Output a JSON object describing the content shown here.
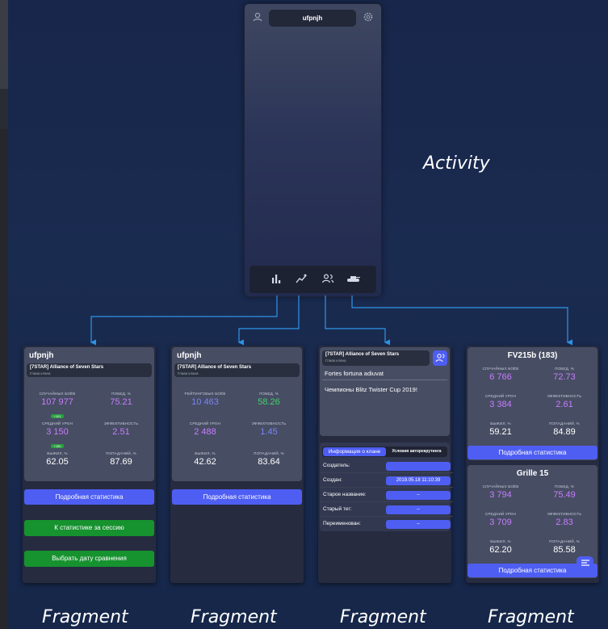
{
  "activity": {
    "title": "ufpnjh",
    "label": "Activity",
    "icons": [
      "profile-icon",
      "settings-icon"
    ],
    "nav_icons": [
      "stats-icon",
      "sessions-icon",
      "clan-icon",
      "tank-icon"
    ]
  },
  "fragment_label": "Fragment",
  "frag1": {
    "player": "ufpnjh",
    "clan_name": "[7STAR] Alliance of Seven Stars",
    "clan_role": "Глава клана",
    "stats": [
      {
        "label": "Случайных боёв",
        "value": "107 977",
        "color": "#c77dff",
        "badge": "+101"
      },
      {
        "label": "Побед, %",
        "value": "75.21",
        "color": "#c77dff",
        "badge": ""
      },
      {
        "label": "Средний урон",
        "value": "3 150",
        "color": "#c77dff",
        "badge": "+150"
      },
      {
        "label": "Эффективность",
        "value": "2.51",
        "color": "#c77dff",
        "badge": ""
      },
      {
        "label": "Выжил, %",
        "value": "62.05",
        "color": "#ffffff",
        "badge": ""
      },
      {
        "label": "Попаданий, %",
        "value": "87.69",
        "color": "#ffffff",
        "badge": ""
      }
    ],
    "btn_details": "Подробная статистика",
    "btn_session": "К статистике за сессию",
    "btn_compare": "Выбрать дату сравнения"
  },
  "frag2": {
    "player": "ufpnjh",
    "clan_name": "[7STAR] Alliance of Seven Stars",
    "clan_role": "Глава клана",
    "stats": [
      {
        "label": "Рейтинговых боёв",
        "value": "10 463",
        "color": "#7a86f5"
      },
      {
        "label": "Побед, %",
        "value": "58.26",
        "color": "#3fd46a"
      },
      {
        "label": "Средний урон",
        "value": "2 488",
        "color": "#c77dff"
      },
      {
        "label": "Эффективность",
        "value": "1.45",
        "color": "#7a86f5"
      },
      {
        "label": "Выжил, %",
        "value": "42.62",
        "color": "#ffffff"
      },
      {
        "label": "Попаданий, %",
        "value": "83.64",
        "color": "#ffffff"
      }
    ],
    "btn_details": "Подробная статистика"
  },
  "frag3": {
    "clan_name": "[7STAR] Alliance of Seven Stars",
    "clan_role": "Глава клана",
    "motto": "Fortes fortuna adiuvat",
    "description": "Чемпионы Blitz Twister Cup 2019!",
    "tab_info": "Информация о клане",
    "tab_conditions": "Условия авторекрутинга",
    "rows": [
      {
        "k": "Создатель:",
        "v": ""
      },
      {
        "k": "Создан:",
        "v": "2019.05.18 11:10:39"
      },
      {
        "k": "Старое название:",
        "v": "--"
      },
      {
        "k": "Старый тег:",
        "v": "--"
      },
      {
        "k": "Переименован:",
        "v": "--"
      }
    ]
  },
  "frag4": {
    "tanks": [
      {
        "name": "FV215b (183)",
        "stats": [
          {
            "label": "Случайных боёв",
            "value": "6 766",
            "color": "#c77dff"
          },
          {
            "label": "Побед, %",
            "value": "72.73",
            "color": "#c77dff"
          },
          {
            "label": "Средний урон",
            "value": "3 384",
            "color": "#c77dff"
          },
          {
            "label": "Эффективность",
            "value": "2.61",
            "color": "#c77dff"
          },
          {
            "label": "Выжил, %",
            "value": "59.21",
            "color": "#ffffff"
          },
          {
            "label": "Попаданий, %",
            "value": "84.89",
            "color": "#ffffff"
          }
        ]
      },
      {
        "name": "Grille 15",
        "stats": [
          {
            "label": "Случайных боёв",
            "value": "3 794",
            "color": "#c77dff"
          },
          {
            "label": "Побед, %",
            "value": "75.49",
            "color": "#c77dff"
          },
          {
            "label": "Средний урон",
            "value": "3 709",
            "color": "#c77dff"
          },
          {
            "label": "Эффективность",
            "value": "2.83",
            "color": "#c77dff"
          },
          {
            "label": "Выжил, %",
            "value": "62.20",
            "color": "#ffffff"
          },
          {
            "label": "Попаданий, %",
            "value": "85.58",
            "color": "#ffffff"
          }
        ]
      }
    ],
    "btn_details": "Подробная статистика"
  }
}
